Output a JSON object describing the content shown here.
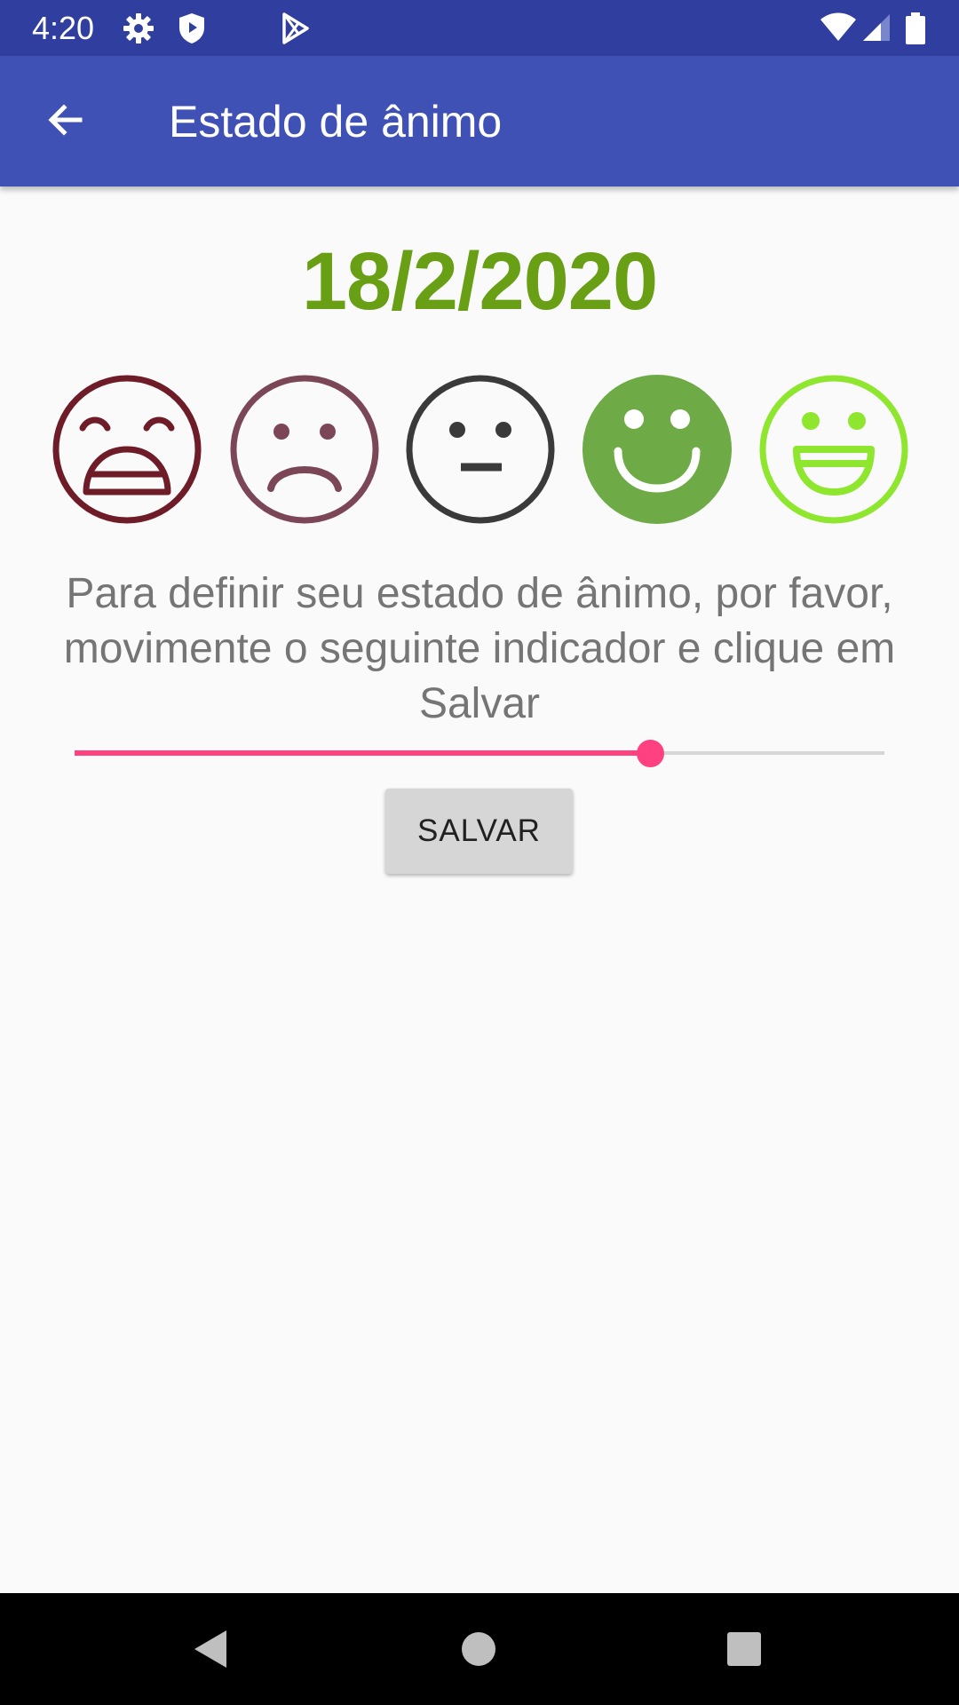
{
  "status_bar": {
    "time": "4:20",
    "icons": [
      "gear-icon",
      "shield-icon",
      "play-store-icon",
      "wifi-icon",
      "signal-icon",
      "battery-icon"
    ]
  },
  "app_bar": {
    "title": "Estado de ânimo",
    "back_icon": "arrow-back-icon"
  },
  "date": "18/2/2020",
  "colors": {
    "status_bar": "#303f9f",
    "app_bar": "#3f51b5",
    "date": "#689f14",
    "accent": "#ff4081",
    "face_very_sad": "#6e1c27",
    "face_sad": "#7b4757",
    "face_neutral": "#3a3a3a",
    "face_happy": "#6eaa45",
    "face_very_happy": "#8ee62e"
  },
  "moods": [
    {
      "icon": "very-sad-face-icon",
      "filled": false
    },
    {
      "icon": "sad-face-icon",
      "filled": false
    },
    {
      "icon": "neutral-face-icon",
      "filled": false
    },
    {
      "icon": "happy-face-icon",
      "filled": true
    },
    {
      "icon": "very-happy-face-icon",
      "filled": false
    }
  ],
  "instructions": "Para definir seu estado de ânimo, por favor, movimente o seguinte indicador e clique em Salvar",
  "slider": {
    "value": 0.71
  },
  "save_button": {
    "label": "SALVAR"
  },
  "nav_bar": {
    "icons": [
      "nav-back-icon",
      "nav-home-icon",
      "nav-recents-icon"
    ]
  }
}
